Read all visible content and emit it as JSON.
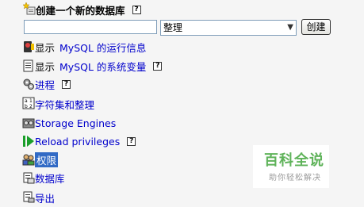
{
  "create_db": {
    "title": "创建一个新的数据库",
    "name_value": "",
    "collation_value": "整理",
    "create_button": "创建"
  },
  "menu": {
    "runtime_info": {
      "prefix": "显示",
      "link": "MySQL 的运行信息"
    },
    "system_vars": {
      "prefix": "显示",
      "link": "MySQL 的系统变量"
    },
    "processes": "进程",
    "charsets": "字符集和整理",
    "storage_engines": "Storage Engines",
    "reload_privileges": "Reload privileges",
    "privileges": "权限",
    "databases": "数据库",
    "export": "导出"
  },
  "help_glyph": "?",
  "watermark": {
    "main": "百科全说",
    "sub": "助你轻松解决"
  }
}
